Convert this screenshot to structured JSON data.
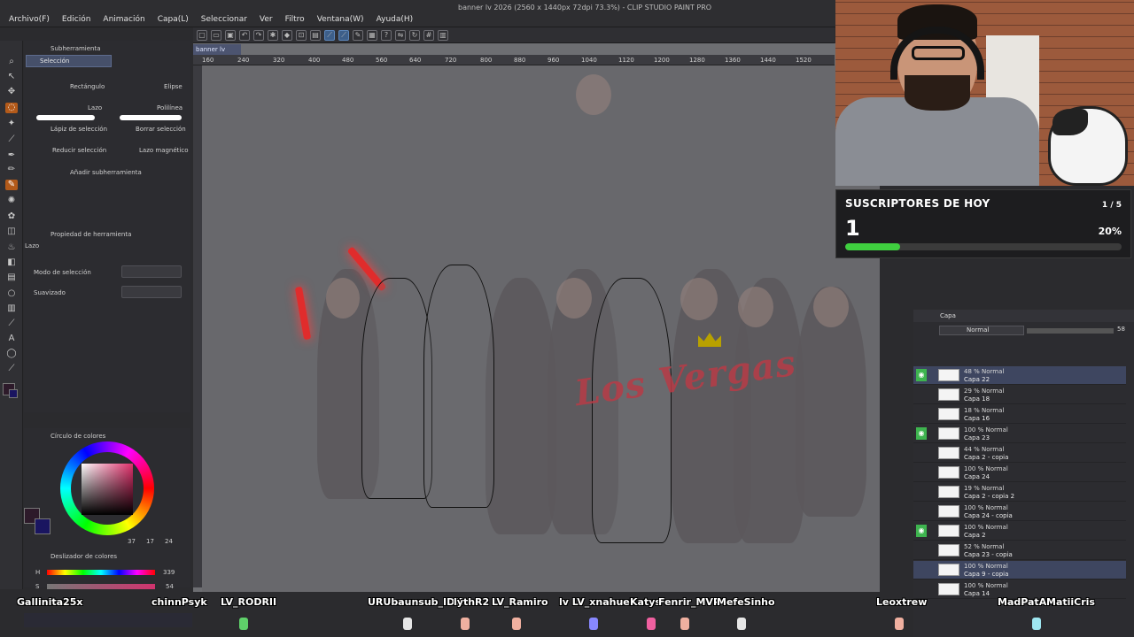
{
  "window": {
    "title": "banner lv 2026 (2560 x 1440px 72dpi 73.3%) - CLIP STUDIO PAINT PRO",
    "menu": [
      "Archivo(F)",
      "Edición",
      "Animación",
      "Capa(L)",
      "Seleccionar",
      "Ver",
      "Filtro",
      "Ventana(W)",
      "Ayuda(H)"
    ]
  },
  "subtool_panel": {
    "tab_label": "Subherramienta",
    "group_label": "Selección",
    "items": [
      "Rectángulo",
      "Elipse",
      "Lazo",
      "Polilínea",
      "Lápiz de selección",
      "Borrar selección",
      "Reducir selección",
      "Lazo magnético"
    ],
    "add_label": "Añadir subherramienta"
  },
  "tool_property": {
    "tab_label": "Propiedad de herramienta",
    "tool_name": "Lazo",
    "rows": [
      "Modo de selección",
      "Suavizado"
    ]
  },
  "color_panel": {
    "tab_label": "Círculo de colores",
    "readout": [
      "37",
      "17",
      "24"
    ],
    "slider_tab": "Deslizador de colores",
    "slider_values": [
      "339",
      "54"
    ],
    "slider_labels": [
      "H",
      "S"
    ],
    "main_color": "#2d1a2a",
    "sub_color": "#1a1560"
  },
  "canvas": {
    "tab": "banner lv 2026",
    "ruler": [
      "160",
      "240",
      "320",
      "400",
      "480",
      "560",
      "640",
      "720",
      "800",
      "880",
      "960",
      "1040",
      "1120",
      "1200",
      "1280",
      "1360",
      "1440",
      "1520"
    ],
    "logo_text": "Los Vergas"
  },
  "subs_widget": {
    "title": "SUSCRIPTORES DE HOY",
    "count_label": "1 / 5",
    "value": "1",
    "percent_label": "20%",
    "progress": 0.2,
    "bar_color": "#3fcf3f"
  },
  "layer_panel": {
    "tab_label": "Capa",
    "blend_mode": "Normal",
    "opacity": "58",
    "layers": [
      {
        "mode": "48 % Normal",
        "name": "Capa 22",
        "visible": true,
        "selected": true
      },
      {
        "mode": "29 % Normal",
        "name": "Capa 18",
        "visible": false,
        "selected": false
      },
      {
        "mode": "18 % Normal",
        "name": "Capa 16",
        "visible": false,
        "selected": false
      },
      {
        "mode": "100 % Normal",
        "name": "Capa 23",
        "visible": true,
        "selected": false
      },
      {
        "mode": "44 % Normal",
        "name": "Capa 2 - copia",
        "visible": false,
        "selected": false
      },
      {
        "mode": "100 % Normal",
        "name": "Capa 24",
        "visible": false,
        "selected": false
      },
      {
        "mode": "19 % Normal",
        "name": "Capa 2 - copia 2",
        "visible": false,
        "selected": false
      },
      {
        "mode": "100 % Normal",
        "name": "Capa 24 - copia",
        "visible": false,
        "selected": false
      },
      {
        "mode": "100 % Normal",
        "name": "Capa 2",
        "visible": true,
        "selected": false
      },
      {
        "mode": "52 % Normal",
        "name": "Capa 23 - copia",
        "visible": false,
        "selected": false
      },
      {
        "mode": "100 % Normal",
        "name": "Capa 9 - copia",
        "visible": false,
        "selected": true
      },
      {
        "mode": "100 % Normal",
        "name": "Capa 14",
        "visible": false,
        "selected": false
      }
    ]
  },
  "viewers": [
    {
      "name": "Gallinita25x"
    },
    {
      "name": "chinnPsyk"
    },
    {
      "name": "LV_RODRII"
    },
    {
      "name": "URUbaunsub_IDK"
    },
    {
      "name": "lythR2"
    },
    {
      "name": "LV_Ramiro"
    },
    {
      "name": "lv LV_xnahuel"
    },
    {
      "name": "Katys"
    },
    {
      "name": "Fenrir_MVP"
    },
    {
      "name": "MefeSinho"
    },
    {
      "name": "Leoxtrew"
    },
    {
      "name": "MadPatArt"
    },
    {
      "name": "MatiiCris"
    }
  ]
}
